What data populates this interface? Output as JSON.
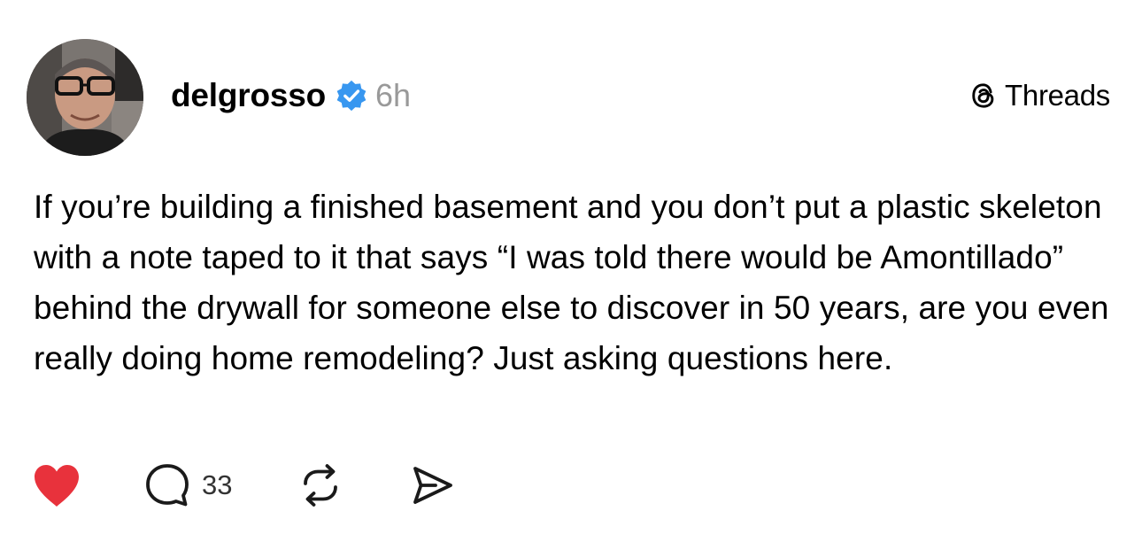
{
  "author": {
    "username": "delgrosso",
    "verified_icon": "verified-badge-icon",
    "timestamp": "6h"
  },
  "brand": {
    "icon": "threads-logo-icon",
    "label": "Threads"
  },
  "post": {
    "text": "If you’re building a finished basement and you don’t put a plastic skeleton with a note taped to it that says “I was told there would be Amontillado” behind the drywall for someone else to discover in 50 years, are you even really doing home remodeling? Just asking questions here."
  },
  "actions": {
    "like_icon": "heart-icon",
    "liked": true,
    "reply_icon": "comment-icon",
    "reply_count": "33",
    "repost_icon": "repost-icon",
    "share_icon": "send-icon"
  },
  "colors": {
    "like_active": "#e8323c",
    "verified": "#3897f0",
    "timestamp": "#999999"
  }
}
